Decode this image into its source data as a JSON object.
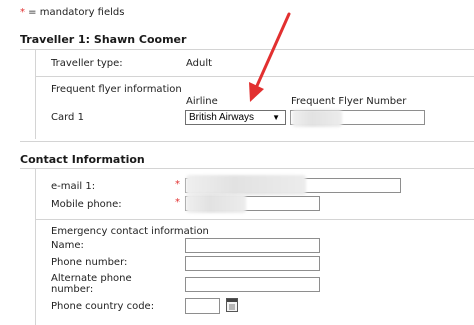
{
  "legend": {
    "star": "*",
    "text": " = mandatory fields"
  },
  "traveller": {
    "heading": "Traveller 1: Shawn Coomer",
    "type_label": "Traveller type:",
    "type_value": "Adult",
    "ff_title": "Frequent flyer information",
    "airline_header": "Airline",
    "ffnum_header": "Frequent Flyer Number",
    "card_label": "Card 1",
    "airline_selected": "British Airways"
  },
  "contact": {
    "heading": "Contact Information",
    "email_label": "e-mail 1:",
    "mobile_label": "Mobile phone:",
    "required_mark": "*"
  },
  "emergency": {
    "title": "Emergency contact information",
    "name_label": "Name:",
    "phone_label": "Phone number:",
    "alt_phone_label_line1": "Alternate phone",
    "alt_phone_label_line2": "number:",
    "country_code_label": "Phone country code:"
  },
  "colors": {
    "accent_red": "#e23030",
    "border": "#8e8e8e"
  },
  "icons": {
    "arrow": "red-arrow-icon",
    "calendar": "calendar-icon"
  }
}
